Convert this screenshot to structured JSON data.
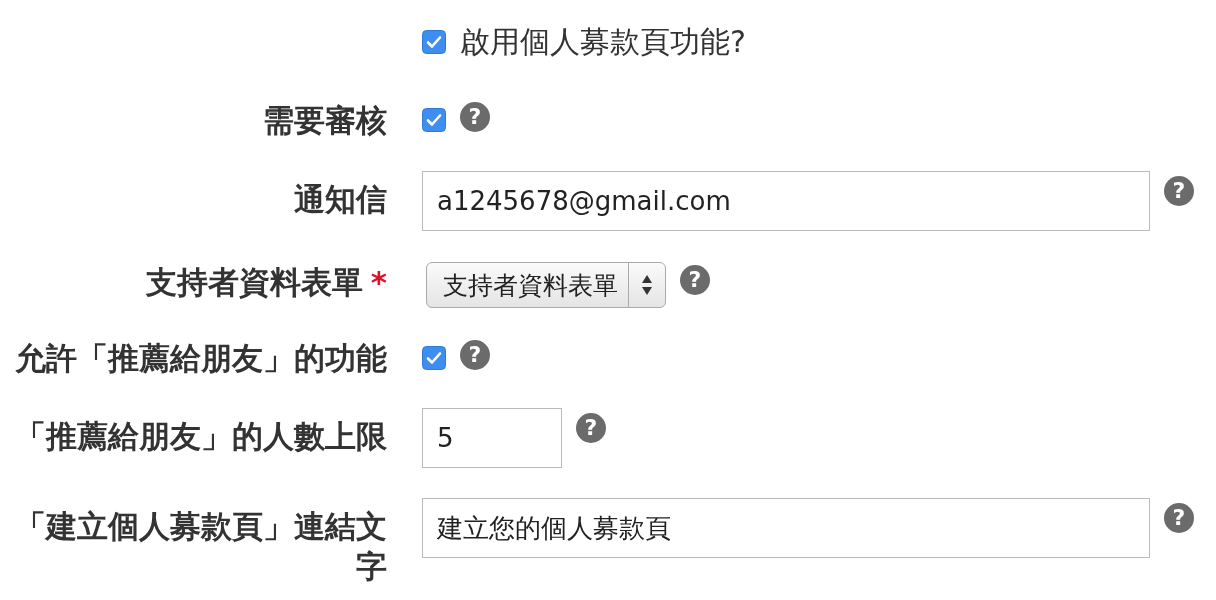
{
  "enable": {
    "label": "啟用個人募款頁功能?",
    "checked": true
  },
  "fields": [
    {
      "kind": "checkbox",
      "label": "需要審核",
      "checked": true,
      "help_icon": "?"
    },
    {
      "kind": "text",
      "label": "通知信",
      "value": "a1245678@gmail.com",
      "help_icon": "?"
    },
    {
      "kind": "select",
      "label": "支持者資料表單",
      "required_mark": "*",
      "value": "支持者資料表單",
      "help_icon": "?"
    },
    {
      "kind": "checkbox",
      "label": "允許「推薦給朋友」的功能",
      "checked": true,
      "help_icon": "?"
    },
    {
      "kind": "number",
      "label": "「推薦給朋友」的人數上限",
      "value": "5",
      "help_icon": "?"
    },
    {
      "kind": "text",
      "label": "「建立個人募款頁」連結文字",
      "value": "建立您的個人募款頁",
      "help_icon": "?"
    }
  ]
}
